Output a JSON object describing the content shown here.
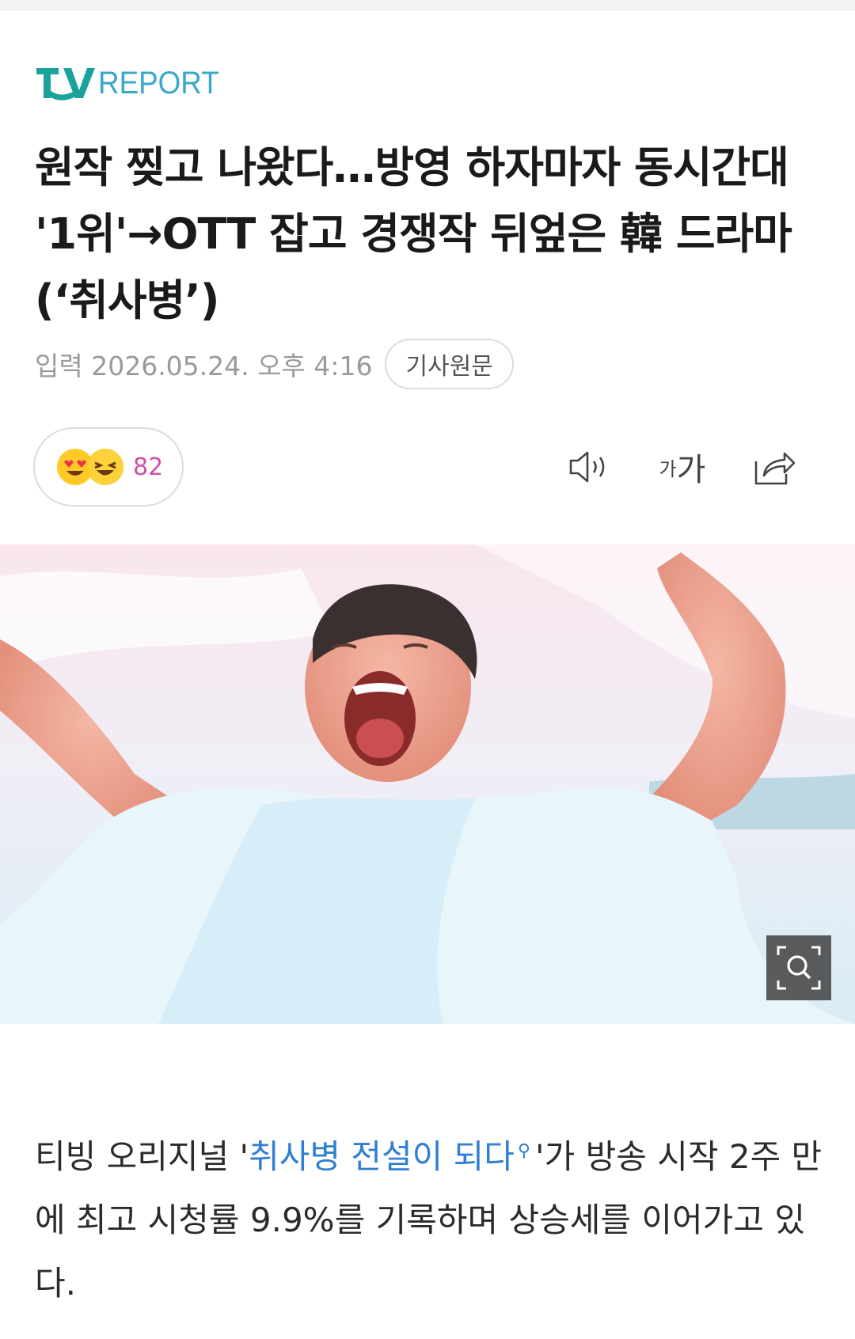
{
  "header": {
    "logo_text": "REPORT",
    "logo_mark": "TV"
  },
  "article": {
    "headline": "원작 찢고 나왔다…방영 하자마자 동시간대 '1위'→OTT 잡고 경쟁작 뒤엎은 韓 드라마 (‘취사병’)",
    "date": "입력 2026.05.24. 오후 4:16",
    "original_label": "기사원문",
    "reaction_count": "82",
    "font_tool_small": "가",
    "font_tool_large": "가",
    "body_prefix": "티빙 오리지널 '",
    "body_link": "취사병 전설이 되다",
    "body_suffix": "'가 방송 시작 2주 만에 최고 시청률 9.9%를 기록하며 상승세를 이어가고 있다."
  },
  "icons": {
    "reaction_icons": [
      "heart-eyes-emoji-icon",
      "laughing-emoji-icon"
    ],
    "toolbar": [
      "speaker-icon",
      "font-size-icon",
      "share-icon"
    ],
    "photo_zoom": "zoom-search-icon",
    "link_search": "search-icon"
  },
  "colors": {
    "brand_teal": "#1aa39a",
    "brand_blue": "#3aa8c8",
    "link": "#2f7fd2",
    "reaction_count": "#d04fa6"
  }
}
